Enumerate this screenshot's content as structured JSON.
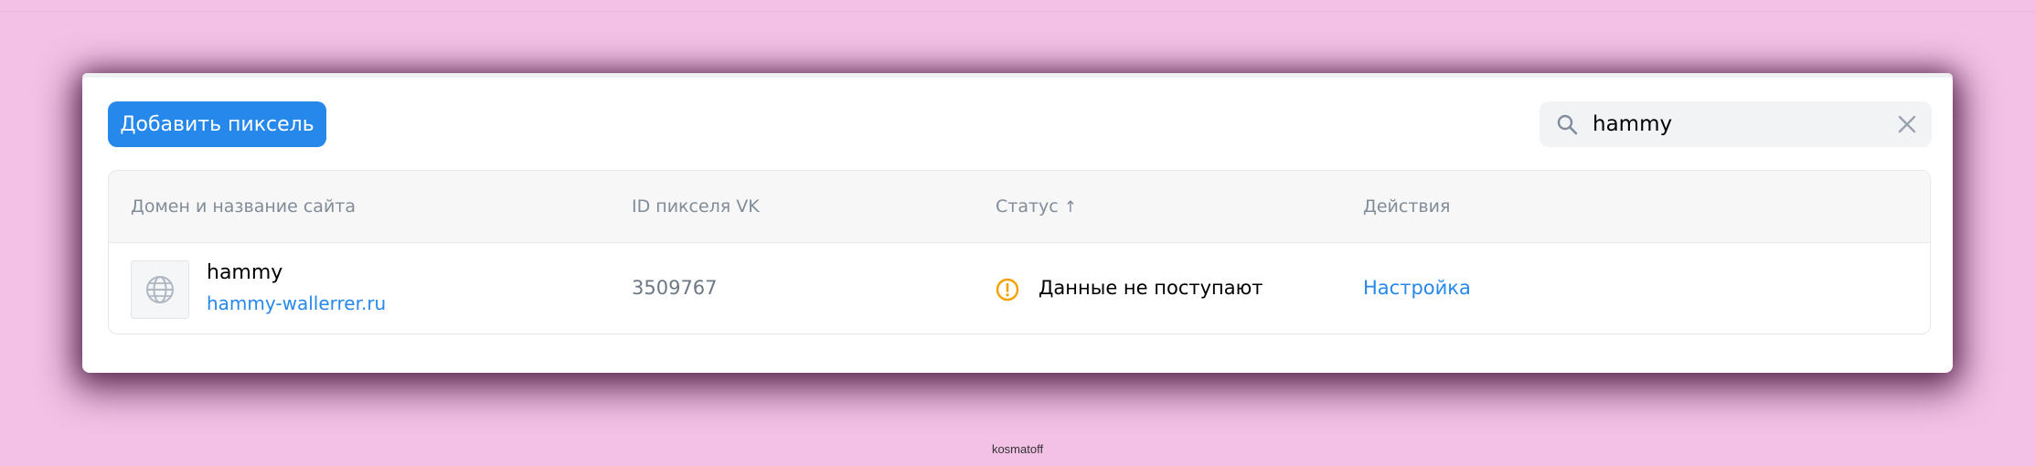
{
  "toolbar": {
    "add_button_label": "Добавить пиксель",
    "accent_color": "#2688eb"
  },
  "search": {
    "value": "hammy",
    "icon": "search-icon",
    "clear_icon": "close-icon"
  },
  "table": {
    "columns": {
      "domain": "Домен и название сайта",
      "pixel_id": "ID пикселя VK",
      "status": "Статус",
      "status_sort": "↑",
      "actions": "Действия"
    },
    "rows": [
      {
        "icon": "globe-icon",
        "site_name": "hammy",
        "domain": "hammy-wallerrer.ru",
        "pixel_id": "3509767",
        "status_icon": "warning-icon",
        "status_color": "#f4a100",
        "status": "Данные не поступают",
        "action": "Настройка"
      }
    ]
  },
  "watermark": "kosmatoff"
}
